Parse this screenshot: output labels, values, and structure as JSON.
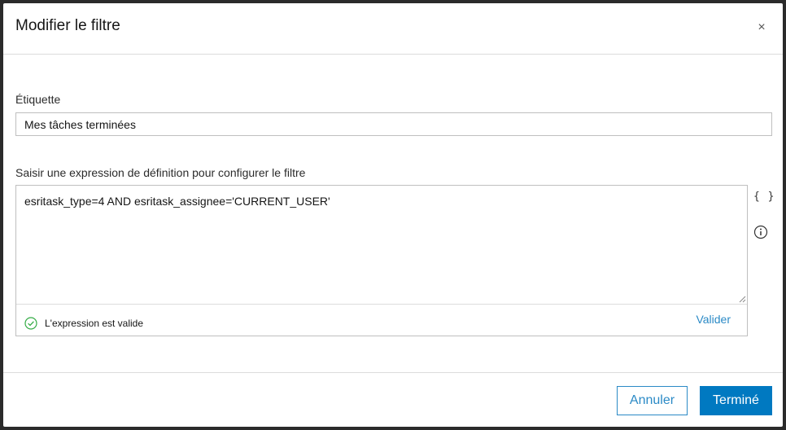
{
  "dialog": {
    "title": "Modifier le filtre",
    "close_symbol": "×"
  },
  "label_field": {
    "label": "Étiquette",
    "value": "Mes tâches terminées"
  },
  "expression": {
    "label": "Saisir une expression de définition pour configurer le filtre",
    "value": "esritask_type=4 AND esritask_assignee='CURRENT_USER'",
    "status_text": "L'expression est valide",
    "validate_label": "Valider",
    "braces_symbol": "{ }"
  },
  "footer": {
    "cancel_label": "Annuler",
    "done_label": "Terminé"
  },
  "colors": {
    "accent": "#0079c1",
    "link": "#2b8ac6",
    "valid_green": "#35ac46"
  },
  "icons": [
    "close-icon",
    "braces-icon",
    "info-icon",
    "check-circle-icon",
    "resize-grip-icon"
  ]
}
